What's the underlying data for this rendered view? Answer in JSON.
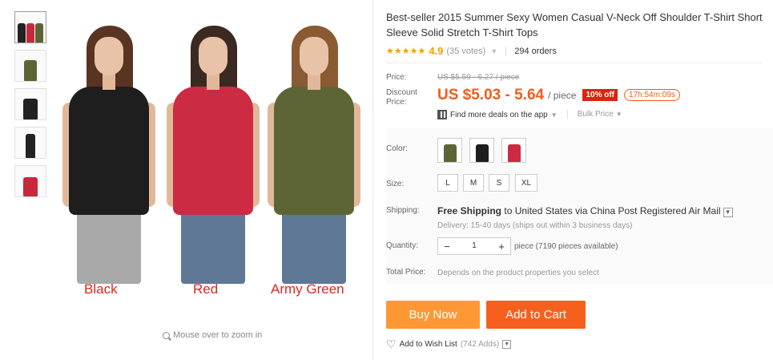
{
  "gallery": {
    "thumbnails": [
      {
        "name": "thumbnail-all-colors",
        "colors": [
          "#222222",
          "#c8283e",
          "#5b6432"
        ]
      },
      {
        "name": "thumbnail-army-green",
        "colors": [
          "#5b6432"
        ]
      },
      {
        "name": "thumbnail-black",
        "colors": [
          "#222222"
        ]
      },
      {
        "name": "thumbnail-black-side",
        "colors": [
          "#222222"
        ]
      },
      {
        "name": "thumbnail-red",
        "colors": [
          "#c8283e"
        ]
      }
    ],
    "models": [
      {
        "label": "Black",
        "shirt_color": "#1e1e1e",
        "hair_color": "#5a3422",
        "jeans": "grey"
      },
      {
        "label": "Red",
        "shirt_color": "#cc2b43",
        "hair_color": "#3b2a22",
        "jeans": "blue"
      },
      {
        "label": "Army Green",
        "shirt_color": "#5d6537",
        "hair_color": "#8a5a33",
        "jeans": "blue"
      }
    ],
    "zoom_hint": "Mouse over to zoom in"
  },
  "product": {
    "title": "Best-seller 2015 Summer Sexy Women Casual V-Neck Off Shoulder T-Shirt Short Sleeve Solid Stretch T-Shirt Tops",
    "stars": "★★★★★",
    "rating": "4.9",
    "votes": "(35 votes)",
    "orders": "294 orders"
  },
  "price": {
    "price_label": "Price:",
    "old_price": "US $5.59 - 6.27 / piece",
    "discount_label": "Discount Price:",
    "current_price": "US $5.03 - 5.64",
    "per_piece": "/ piece",
    "discount_badge": "10% off",
    "timer": "17h:54m:09s",
    "deals_text": "Find more deals on the app",
    "bulk_price": "Bulk Price"
  },
  "options": {
    "color_label": "Color:",
    "colors": [
      "#5d6537",
      "#1e1e1e",
      "#cc2b43"
    ],
    "size_label": "Size:",
    "sizes": [
      "L",
      "M",
      "S",
      "XL"
    ],
    "shipping_label": "Shipping:",
    "shipping_free": "Free Shipping",
    "shipping_to": "to",
    "shipping_country": "United States",
    "shipping_via": "via",
    "shipping_method": "China Post Registered Air Mail",
    "delivery": "Delivery: 15-40 days (ships out within 3 business days)",
    "quantity_label": "Quantity:",
    "quantity_value": "1",
    "availability": "piece (7190 pieces available)",
    "total_label": "Total Price:",
    "total_text": "Depends on the product properties you select"
  },
  "actions": {
    "buy_now": "Buy Now",
    "add_to_cart": "Add to Cart",
    "wishlist": "Add to Wish List",
    "wish_count": "(742 Adds)"
  }
}
